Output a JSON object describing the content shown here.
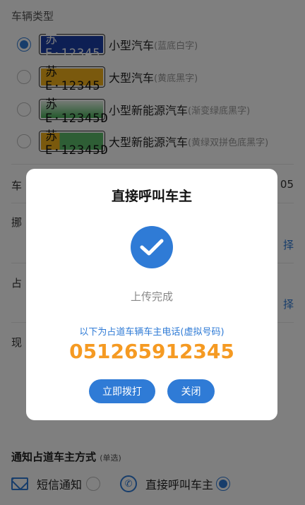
{
  "vehicle_type": {
    "title": "车辆类型",
    "options": [
      {
        "plate": "苏E·12345",
        "name": "小型汽车",
        "desc": "(蓝底白字)",
        "checked": true
      },
      {
        "plate": "苏E·12345",
        "name": "大型汽车",
        "desc": "(黄底黑字)",
        "checked": false
      },
      {
        "plate": "苏E·12345D",
        "name": "小型新能源汽车",
        "desc": "(渐变绿底黑字)",
        "checked": false
      },
      {
        "plate": "苏E·12345D",
        "name": "大型新能源汽车",
        "desc": "(黄绿双拼色底黑字)",
        "checked": false
      }
    ]
  },
  "form": {
    "row1_label": "车",
    "row1_value": "05",
    "row2_label": "挪",
    "row2_link": "择",
    "row3_label": "占",
    "row3_link": "择",
    "row4_label": "现"
  },
  "notify": {
    "title": "通知占道车主方式",
    "subtitle": "(单选)",
    "sms_label": "短信通知",
    "call_label": "直接呼叫车主"
  },
  "modal": {
    "title": "直接呼叫车主",
    "status": "上传完成",
    "note": "以下为占道车辆车主电话(虚拟号码)",
    "phone": "051265912345",
    "call_button": "立即拨打",
    "close_button": "关闭"
  },
  "colors": {
    "accent": "#2f7bd6",
    "phone_orange": "#f59a22"
  }
}
